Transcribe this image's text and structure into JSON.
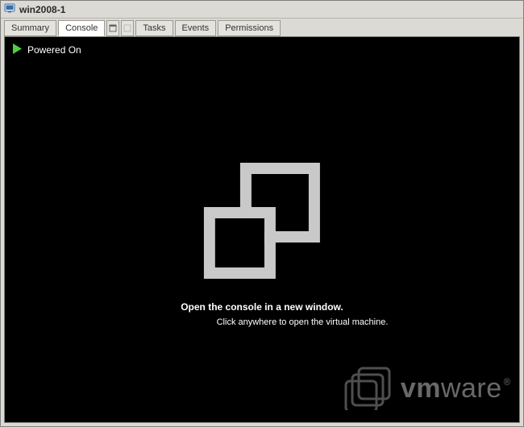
{
  "window": {
    "title": "win2008-1"
  },
  "tabs": {
    "summary": "Summary",
    "console": "Console",
    "tasks": "Tasks",
    "events": "Events",
    "permissions": "Permissions",
    "active_index": 1
  },
  "console": {
    "status": "Powered On",
    "open_line": "Open the console in a new window.",
    "click_line": "Click anywhere to open the virtual machine."
  },
  "branding": {
    "name_bold": "vm",
    "name_light": "ware"
  }
}
